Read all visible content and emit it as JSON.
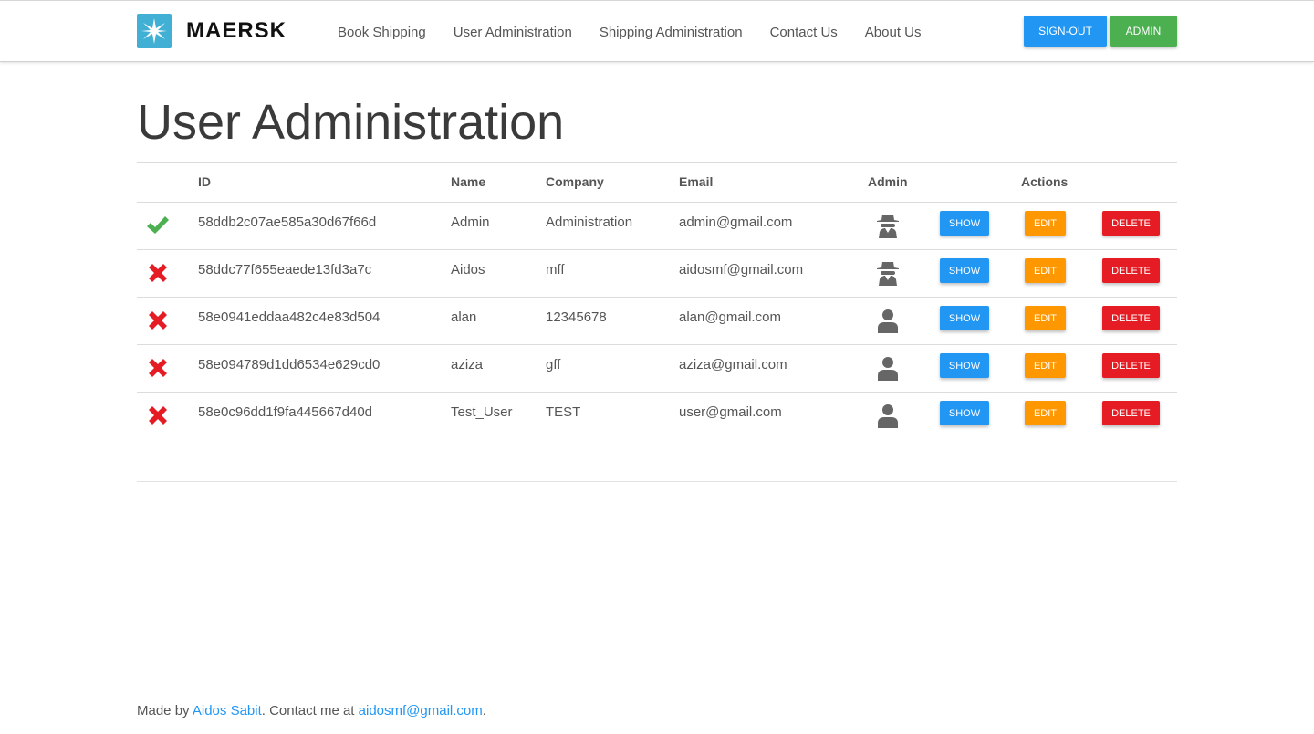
{
  "header": {
    "brand": "MAERSK",
    "nav": [
      "Book Shipping",
      "User Administration",
      "Shipping Administration",
      "Contact Us",
      "About Us"
    ],
    "signout_label": "SIGN-OUT",
    "admin_label": "ADMIN"
  },
  "page": {
    "title": "User Administration"
  },
  "table": {
    "headers": {
      "id": "ID",
      "name": "Name",
      "company": "Company",
      "email": "Email",
      "admin": "Admin",
      "actions": "Actions"
    },
    "buttons": {
      "show": "SHOW",
      "edit": "EDIT",
      "delete": "DELETE"
    },
    "rows": [
      {
        "status": "check-icon",
        "id": "58ddb2c07ae585a30d67f66d",
        "name": "Admin",
        "company": "Administration",
        "email": "admin@gmail.com",
        "role_icon": "spy-icon"
      },
      {
        "status": "cross-icon",
        "id": "58ddc77f655eaede13fd3a7c",
        "name": "Aidos",
        "company": "mff",
        "email": "aidosmf@gmail.com",
        "role_icon": "spy-icon"
      },
      {
        "status": "cross-icon",
        "id": "58e0941eddaa482c4e83d504",
        "name": "alan",
        "company": "12345678",
        "email": "alan@gmail.com",
        "role_icon": "user-icon"
      },
      {
        "status": "cross-icon",
        "id": "58e094789d1dd6534e629cd0",
        "name": "aziza",
        "company": "gff",
        "email": "aziza@gmail.com",
        "role_icon": "user-icon"
      },
      {
        "status": "cross-icon",
        "id": "58e0c96dd1f9fa445667d40d",
        "name": "Test_User",
        "company": "TEST",
        "email": "user@gmail.com",
        "role_icon": "user-icon"
      }
    ]
  },
  "footer": {
    "prefix": "Made by ",
    "author": "Aidos Sabit",
    "middle": ". Contact me at ",
    "email": "aidosmf@gmail.com",
    "suffix": "."
  },
  "colors": {
    "primary": "#2196f3",
    "success": "#4caf50",
    "warning": "#ff9800",
    "danger": "#e51c23",
    "brand": "#42b0d5"
  }
}
